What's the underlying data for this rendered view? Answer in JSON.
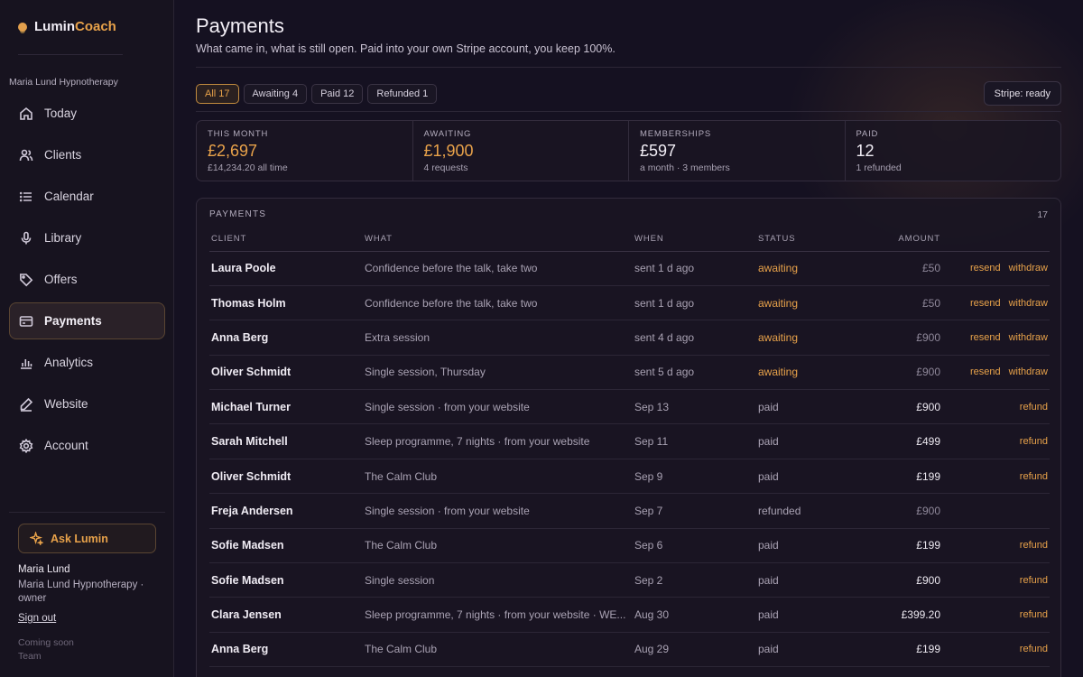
{
  "brand": {
    "name_part1": "Lumin",
    "name_part2": "Coach"
  },
  "practice": "Maria Lund Hypnotherapy",
  "nav": [
    {
      "label": "Today",
      "icon": "home-icon"
    },
    {
      "label": "Clients",
      "icon": "users-icon"
    },
    {
      "label": "Calendar",
      "icon": "list-icon"
    },
    {
      "label": "Library",
      "icon": "microphone-icon"
    },
    {
      "label": "Offers",
      "icon": "tag-icon"
    },
    {
      "label": "Payments",
      "icon": "card-icon",
      "active": true
    },
    {
      "label": "Analytics",
      "icon": "bar-chart-icon"
    },
    {
      "label": "Website",
      "icon": "edit-icon"
    },
    {
      "label": "Account",
      "icon": "gear-icon"
    }
  ],
  "sidebar_footer": {
    "ask_label": "Ask Lumin",
    "user_name": "Maria Lund",
    "user_role": "Maria Lund Hypnotherapy · owner",
    "sign_out": "Sign out",
    "coming_soon": "Coming soon",
    "team": "Team"
  },
  "page": {
    "title": "Payments",
    "subtitle": "What came in, what is still open. Paid into your own Stripe account, you keep 100%."
  },
  "filters": [
    {
      "label": "All 17",
      "active": true
    },
    {
      "label": "Awaiting 4"
    },
    {
      "label": "Paid 12"
    },
    {
      "label": "Refunded 1"
    }
  ],
  "stripe_status": "Stripe: ready",
  "stats": [
    {
      "label": "THIS MONTH",
      "value": "£2,697",
      "sub": "£14,234.20 all time",
      "accent": true
    },
    {
      "label": "AWAITING",
      "value": "£1,900",
      "sub": "4 requests",
      "accent": true
    },
    {
      "label": "MEMBERSHIPS",
      "value": "£597",
      "sub": "a month · 3 members"
    },
    {
      "label": "PAID",
      "value": "12",
      "sub": "1 refunded"
    }
  ],
  "payments_panel": {
    "heading": "PAYMENTS",
    "count": "17",
    "columns": [
      "CLIENT",
      "WHAT",
      "WHEN",
      "STATUS",
      "AMOUNT"
    ],
    "rows": [
      {
        "client": "Laura Poole",
        "what": "Confidence before the talk, take two",
        "when": "sent 1 d ago",
        "status": "awaiting",
        "amount": "£50",
        "actions": [
          "resend",
          "withdraw"
        ]
      },
      {
        "client": "Thomas Holm",
        "what": "Confidence before the talk, take two",
        "when": "sent 1 d ago",
        "status": "awaiting",
        "amount": "£50",
        "actions": [
          "resend",
          "withdraw"
        ]
      },
      {
        "client": "Anna Berg",
        "what": "Extra session",
        "when": "sent 4 d ago",
        "status": "awaiting",
        "amount": "£900",
        "actions": [
          "resend",
          "withdraw"
        ]
      },
      {
        "client": "Oliver Schmidt",
        "what": "Single session, Thursday",
        "when": "sent 5 d ago",
        "status": "awaiting",
        "amount": "£900",
        "actions": [
          "resend",
          "withdraw"
        ]
      },
      {
        "client": "Michael Turner",
        "what": "Single session · from your website",
        "when": "Sep 13",
        "status": "paid",
        "amount": "£900",
        "actions": [
          "refund"
        ]
      },
      {
        "client": "Sarah Mitchell",
        "what": "Sleep programme, 7 nights · from your website",
        "when": "Sep 11",
        "status": "paid",
        "amount": "£499",
        "actions": [
          "refund"
        ]
      },
      {
        "client": "Oliver Schmidt",
        "what": "The Calm Club",
        "when": "Sep 9",
        "status": "paid",
        "amount": "£199",
        "actions": [
          "refund"
        ]
      },
      {
        "client": "Freja Andersen",
        "what": "Single session · from your website",
        "when": "Sep 7",
        "status": "refunded",
        "amount": "£900",
        "actions": []
      },
      {
        "client": "Sofie Madsen",
        "what": "The Calm Club",
        "when": "Sep 6",
        "status": "paid",
        "amount": "£199",
        "actions": [
          "refund"
        ]
      },
      {
        "client": "Sofie Madsen",
        "what": "Single session",
        "when": "Sep 2",
        "status": "paid",
        "amount": "£900",
        "actions": [
          "refund"
        ]
      },
      {
        "client": "Clara Jensen",
        "what": "Sleep programme, 7 nights · from your website · WE...",
        "when": "Aug 30",
        "status": "paid",
        "amount": "£399.20",
        "actions": [
          "refund"
        ]
      },
      {
        "client": "Anna Berg",
        "what": "The Calm Club",
        "when": "Aug 29",
        "status": "paid",
        "amount": "£199",
        "actions": [
          "refund"
        ]
      }
    ]
  }
}
